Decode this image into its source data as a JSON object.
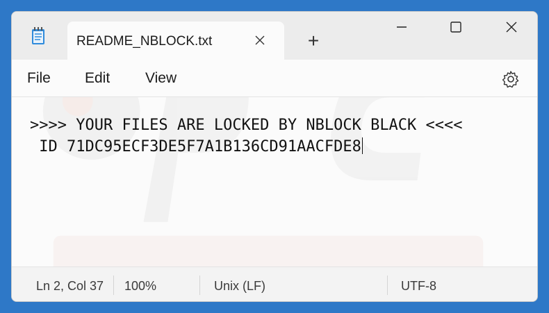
{
  "window": {
    "tab_title": "README_NBLOCK.txt",
    "new_tab_symbol": "+"
  },
  "menu": {
    "file": "File",
    "edit": "Edit",
    "view": "View"
  },
  "document": {
    "lines": [
      ">>>> YOUR FILES ARE LOCKED BY NBLOCK BLACK <<<<",
      " ID 71DC95ECF3DE5F7A1B136CD91AACFDE8"
    ]
  },
  "status": {
    "position": "Ln 2, Col 37",
    "zoom": "100%",
    "line_ending": "Unix (LF)",
    "encoding": "UTF-8"
  },
  "colors": {
    "desktop": "#2e78c7",
    "titlebar": "#ececec",
    "editor_bg": "#fbfbfb",
    "statusbar": "#f3f3f3",
    "app_icon": "#2e8bdc"
  },
  "icons": {
    "app": "notepad-icon",
    "tab_close": "close-icon",
    "minimize": "minimize-icon",
    "maximize": "maximize-icon",
    "close": "close-icon",
    "settings": "gear-icon"
  }
}
